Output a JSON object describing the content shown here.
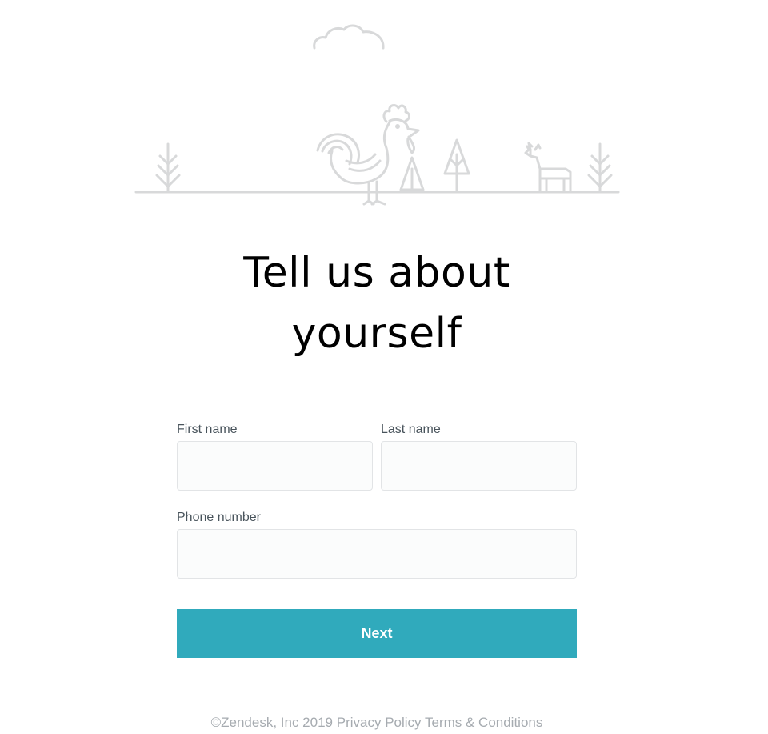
{
  "page": {
    "title_line1": "Tell us about",
    "title_line2": "yourself"
  },
  "illustration": {
    "icons": [
      "cloud-icon",
      "rooster-icon",
      "pine-tree-icon",
      "deer-icon",
      "bare-tree-icon"
    ],
    "stroke_color": "#d8d9da"
  },
  "form": {
    "first_name_label": "First name",
    "first_name_value": "",
    "last_name_label": "Last name",
    "last_name_value": "",
    "phone_label": "Phone number",
    "phone_value": "",
    "next_label": "Next"
  },
  "footer": {
    "copyright": "©Zendesk, Inc 2019",
    "privacy_link": "Privacy Policy",
    "terms_link": "Terms & Conditions"
  },
  "colors": {
    "accent": "#30aabc",
    "label_text": "#49545c",
    "footer_text": "#a6abb0",
    "input_border": "#e2e4e6"
  }
}
